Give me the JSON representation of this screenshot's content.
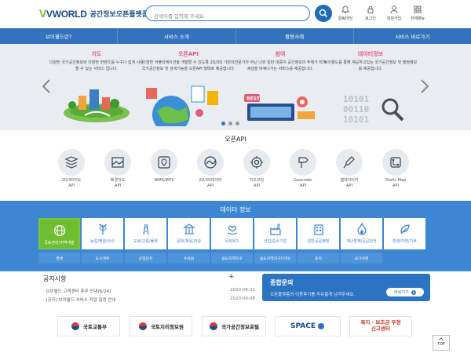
{
  "header": {
    "logo": "VWORLD",
    "logo_sub": "공간정보오픈플랫폼",
    "search_placeholder": "검색어를 입력해 주세요.",
    "utils": [
      {
        "label": "알림마당",
        "icon": "bell-icon"
      },
      {
        "label": "로그인",
        "icon": "lock-icon"
      },
      {
        "label": "회원가입",
        "icon": "user-icon"
      },
      {
        "label": "전체메뉴",
        "icon": "grid-menu-icon"
      }
    ]
  },
  "nav": {
    "items": [
      "브이월드란?",
      "서비스 소개",
      "활용사례",
      "서비스 바로가기"
    ]
  },
  "carousel": {
    "slides": [
      {
        "title": "지도",
        "desc": "다양한 국가공간정보와 다양한 컨텐츠를 누구나 쉽게 사용할 수 있는 서비스 입니다."
      },
      {
        "title": "오픈API",
        "desc": "다양한 어플리케이션을 개발할 수 있도록 2D/3D 기반의 국가공간정보 및 검색기능을 오픈API 형태로 제공합니다."
      },
      {
        "title": "참여",
        "desc": "전문가가 아닌 나와 일반 대중이 공간정보의 주체가 되어 세상을 바꿔나가는 서비스를 제공합니다."
      },
      {
        "title": "데이터정보",
        "desc": "브이월드를 통해 제공하고있는 국가공간정보 및 행정정보를 제공합니다."
      }
    ],
    "badge": "BEST",
    "binary": [
      "10101",
      "00110",
      "10101"
    ]
  },
  "openapi": {
    "title": "오픈API",
    "items": [
      {
        "label": "2D/3D지도\nAPI",
        "icon": "map-3d-icon"
      },
      {
        "label": "배경지도\nAPI",
        "icon": "background-map-icon"
      },
      {
        "label": "WMS/WFS",
        "icon": "wms-wfs-icon"
      },
      {
        "label": "2D/3D데이터\nAPI",
        "icon": "data-api-icon"
      },
      {
        "label": "지오코딩\nAPI",
        "icon": "geocoding-icon"
      },
      {
        "label": "Geocoder\nAPI",
        "icon": "geocoder-icon"
      },
      {
        "label": "웹레이어지\nAPI",
        "icon": "web-layer-icon"
      },
      {
        "label": "Static Map\nAPI",
        "icon": "static-map-icon"
      }
    ]
  },
  "data_info": {
    "title": "데이터 정보",
    "tiles": [
      {
        "label": "국토관리/지역개발",
        "icon": "globe-icon",
        "active": true
      },
      {
        "label": "농업/해양/수산",
        "icon": "agriculture-icon"
      },
      {
        "label": "도로/교통/물류",
        "icon": "road-icon"
      },
      {
        "label": "문화/체육/관광",
        "icon": "culture-icon"
      },
      {
        "label": "사회복지",
        "icon": "welfare-icon"
      },
      {
        "label": "산업/중소기업",
        "icon": "industry-icon"
      },
      {
        "label": "일반공공행정",
        "icon": "government-icon"
      },
      {
        "label": "재난방재/공공안전",
        "icon": "fire-icon"
      },
      {
        "label": "환경/자연/기후",
        "icon": "environment-icon"
      }
    ],
    "subs": [
      "경계",
      "도시계획",
      "산업단지",
      "수자원",
      "용도지역지구",
      "용도지역지구(기타)",
      "토지",
      "국가지명"
    ]
  },
  "notice": {
    "title": "공지사항",
    "plus": "+",
    "items": [
      {
        "text": "· 브이월드 고객센터 휴무 안내(6/24)",
        "date": "2020-06-22"
      },
      {
        "text": "· [공지] 브이월드 서비스 작업 일정 안내",
        "date": "2020-06-08"
      }
    ]
  },
  "center": {
    "title": "종합문의",
    "desc": "오픈플랫폼의 이용후기를 자유롭게 남겨주세요.",
    "button": "바로가기"
  },
  "partners": [
    {
      "text": "국토교통부"
    },
    {
      "text": "국토지리정보원"
    },
    {
      "text": "국가공간정보포털"
    },
    {
      "text": "SPACE"
    },
    {
      "text": "복지 · 보조금 부정신고센터"
    }
  ],
  "top_button": "TOP",
  "colors": {
    "primary": "#3373be",
    "data_bg": "#3d86d1",
    "active_tile": "#6fbe32",
    "slide_title": "#e45a7a"
  }
}
